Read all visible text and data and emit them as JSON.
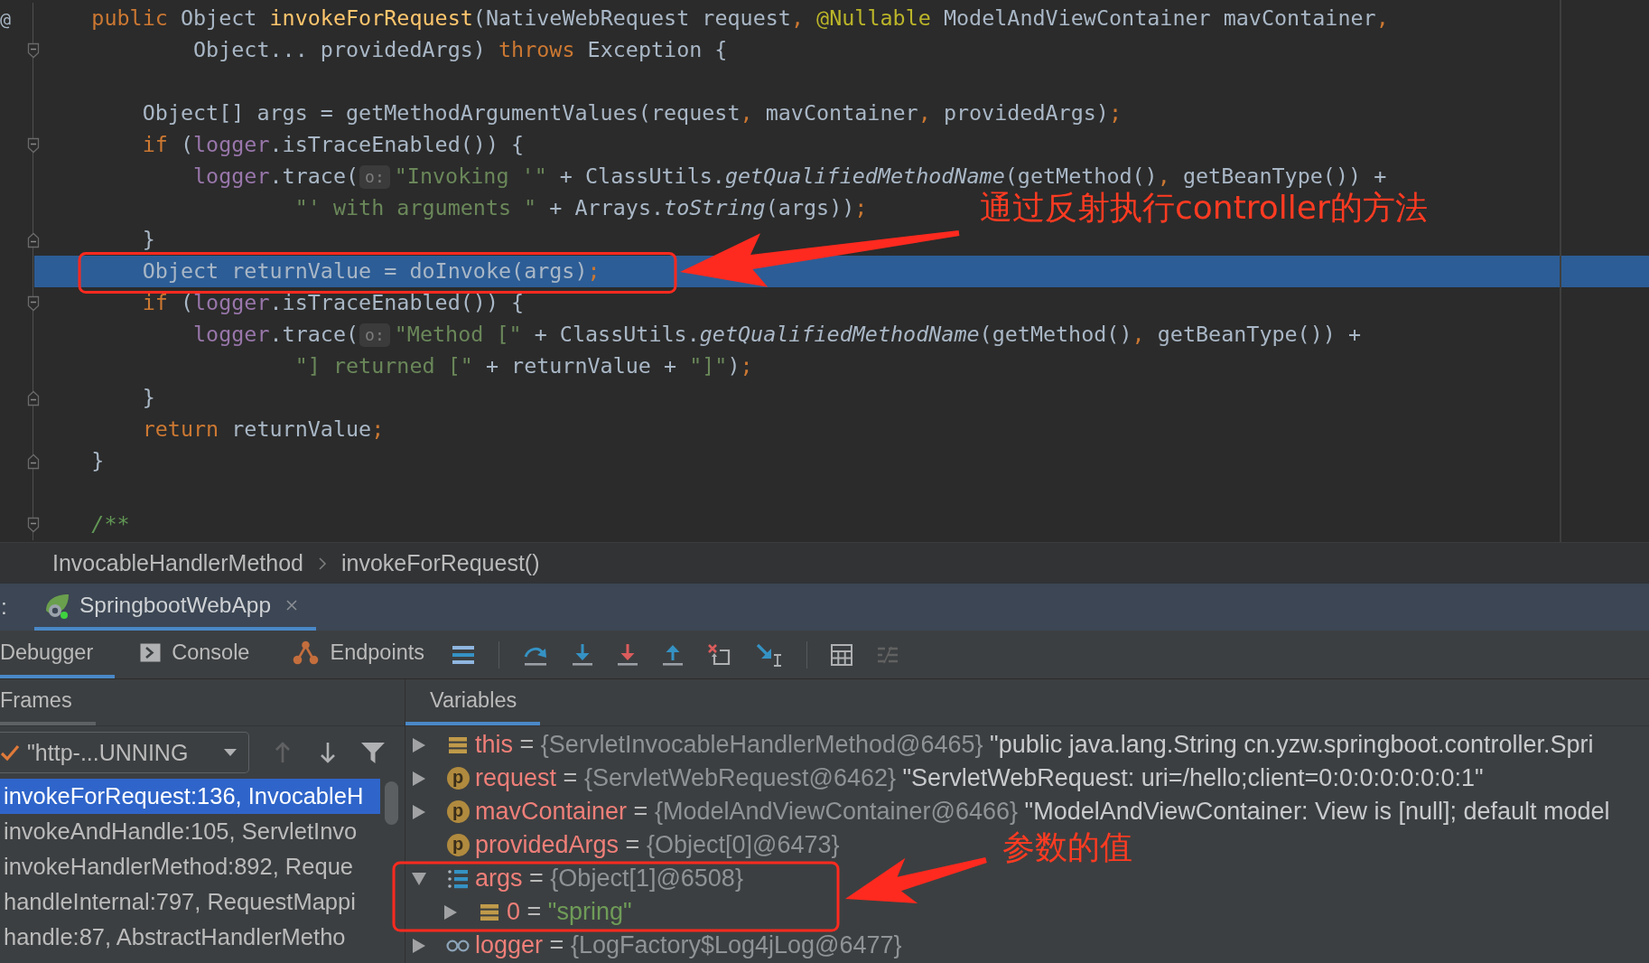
{
  "editor": {
    "lines": [
      {
        "kind": "statement",
        "highlighted": false,
        "fold_open": false,
        "fold_close": false,
        "gutter": "@",
        "tokens": [
          {
            "kind": "keyword",
            "text": "public"
          },
          {
            "kind": "plain",
            "text": " Object "
          },
          {
            "kind": "declaration",
            "text": "invokeForRequest"
          },
          {
            "kind": "plain",
            "text": "(NativeWebRequest request"
          },
          {
            "kind": "punct",
            "text": ", "
          },
          {
            "kind": "annotation",
            "text": "@Nullable"
          },
          {
            "kind": "plain",
            "text": " ModelAndViewContainer mavContainer"
          },
          {
            "kind": "punct",
            "text": ","
          }
        ],
        "children": [
          {
            "kind": "continuation",
            "highlighted": false,
            "fold_open": true,
            "fold_close": false,
            "tokens": [
              {
                "kind": "plain",
                "text": "Object... providedArgs) "
              },
              {
                "kind": "keyword",
                "text": "throws"
              },
              {
                "kind": "plain",
                "text": " Exception {"
              }
            ]
          },
          {
            "kind": "blank"
          },
          {
            "kind": "statement",
            "highlighted": false,
            "fold_open": false,
            "fold_close": false,
            "tokens": [
              {
                "kind": "plain",
                "text": "Object[] args = getMethodArgumentValues(request"
              },
              {
                "kind": "punct",
                "text": ", "
              },
              {
                "kind": "plain",
                "text": "mavContainer"
              },
              {
                "kind": "punct",
                "text": ", "
              },
              {
                "kind": "plain",
                "text": "providedArgs)"
              },
              {
                "kind": "punct",
                "text": ";"
              }
            ]
          },
          {
            "kind": "statement",
            "highlighted": false,
            "fold_open": true,
            "fold_close": false,
            "tokens": [
              {
                "kind": "keyword",
                "text": "if"
              },
              {
                "kind": "plain",
                "text": " ("
              },
              {
                "kind": "field",
                "text": "logger"
              },
              {
                "kind": "plain",
                "text": ".isTraceEnabled()) {"
              }
            ],
            "children": [
              {
                "kind": "statement",
                "highlighted": false,
                "fold_open": false,
                "fold_close": false,
                "tokens": [
                  {
                    "kind": "field",
                    "text": "logger"
                  },
                  {
                    "kind": "plain",
                    "text": ".trace("
                  },
                  {
                    "kind": "hint",
                    "text": "o:"
                  },
                  {
                    "kind": "string",
                    "text": "\"Invoking '\""
                  },
                  {
                    "kind": "plain",
                    "text": " + ClassUtils."
                  },
                  {
                    "kind": "italic",
                    "text": "getQualifiedMethodName"
                  },
                  {
                    "kind": "plain",
                    "text": "(getMethod()"
                  },
                  {
                    "kind": "punct",
                    "text": ", "
                  },
                  {
                    "kind": "plain",
                    "text": "getBeanType()) +"
                  }
                ],
                "children": [
                  {
                    "kind": "continuation",
                    "highlighted": false,
                    "fold_open": false,
                    "fold_close": false,
                    "tokens": [
                      {
                        "kind": "string",
                        "text": "\"' with arguments \""
                      },
                      {
                        "kind": "plain",
                        "text": " + Arrays."
                      },
                      {
                        "kind": "italic",
                        "text": "toString"
                      },
                      {
                        "kind": "plain",
                        "text": "(args))"
                      },
                      {
                        "kind": "punct",
                        "text": ";"
                      }
                    ]
                  }
                ]
              }
            ]
          },
          {
            "kind": "statement",
            "highlighted": false,
            "fold_open": false,
            "fold_close": true,
            "tokens": [
              {
                "kind": "plain",
                "text": "}"
              }
            ]
          },
          {
            "kind": "statement",
            "highlighted": true,
            "fold_open": false,
            "fold_close": false,
            "tokens": [
              {
                "kind": "plain",
                "text": "Object returnValue = doInvoke(args)"
              },
              {
                "kind": "punct",
                "text": ";"
              }
            ]
          },
          {
            "kind": "statement",
            "highlighted": false,
            "fold_open": true,
            "fold_close": false,
            "tokens": [
              {
                "kind": "keyword",
                "text": "if"
              },
              {
                "kind": "plain",
                "text": " ("
              },
              {
                "kind": "field",
                "text": "logger"
              },
              {
                "kind": "plain",
                "text": ".isTraceEnabled()) {"
              }
            ],
            "children": [
              {
                "kind": "statement",
                "highlighted": false,
                "fold_open": false,
                "fold_close": false,
                "tokens": [
                  {
                    "kind": "field",
                    "text": "logger"
                  },
                  {
                    "kind": "plain",
                    "text": ".trace("
                  },
                  {
                    "kind": "hint",
                    "text": "o:"
                  },
                  {
                    "kind": "string",
                    "text": "\"Method [\""
                  },
                  {
                    "kind": "plain",
                    "text": " + ClassUtils."
                  },
                  {
                    "kind": "italic",
                    "text": "getQualifiedMethodName"
                  },
                  {
                    "kind": "plain",
                    "text": "(getMethod()"
                  },
                  {
                    "kind": "punct",
                    "text": ", "
                  },
                  {
                    "kind": "plain",
                    "text": "getBeanType()) +"
                  }
                ],
                "children": [
                  {
                    "kind": "continuation",
                    "highlighted": false,
                    "fold_open": false,
                    "fold_close": false,
                    "tokens": [
                      {
                        "kind": "string",
                        "text": "\"] returned [\""
                      },
                      {
                        "kind": "plain",
                        "text": " + returnValue + "
                      },
                      {
                        "kind": "string",
                        "text": "\"]\""
                      },
                      {
                        "kind": "plain",
                        "text": ")"
                      },
                      {
                        "kind": "punct",
                        "text": ";"
                      }
                    ]
                  }
                ]
              }
            ]
          },
          {
            "kind": "statement",
            "highlighted": false,
            "fold_open": false,
            "fold_close": true,
            "tokens": [
              {
                "kind": "plain",
                "text": "}"
              }
            ]
          },
          {
            "kind": "statement",
            "highlighted": false,
            "fold_open": false,
            "fold_close": false,
            "tokens": [
              {
                "kind": "keyword",
                "text": "return"
              },
              {
                "kind": "plain",
                "text": " returnValue"
              },
              {
                "kind": "punct",
                "text": ";"
              }
            ]
          }
        ]
      },
      {
        "kind": "statement",
        "highlighted": false,
        "fold_open": false,
        "fold_close": true,
        "tokens": [
          {
            "kind": "plain",
            "text": "}"
          }
        ]
      },
      {
        "kind": "blank"
      },
      {
        "kind": "statement",
        "highlighted": false,
        "fold_open": true,
        "fold_close": false,
        "tokens": [
          {
            "kind": "comment",
            "text": "/**"
          }
        ]
      }
    ]
  },
  "breadcrumbs": {
    "items": [
      "InvocableHandlerMethod",
      "invokeForRequest()"
    ]
  },
  "run_tabs": {
    "label": ":",
    "tabs": [
      {
        "label": "SpringbootWebApp",
        "selected": true
      }
    ]
  },
  "debug_toolbar": {
    "tabs": [
      {
        "label": "Debugger",
        "selected": true
      },
      {
        "label": "Console",
        "selected": false
      },
      {
        "label": "Endpoints",
        "selected": false
      }
    ],
    "buttons": [
      {
        "disabled": false
      },
      {
        "disabled": false
      },
      {
        "disabled": false
      },
      {
        "disabled": false
      },
      {
        "disabled": false
      },
      {
        "disabled": false
      },
      {
        "disabled": false
      },
      {
        "disabled": false
      },
      {
        "disabled": true
      }
    ]
  },
  "frames": {
    "title": "Frames",
    "focused": false,
    "thread": "\"http-...UNNING",
    "controls": [
      {
        "disabled": true
      },
      {
        "disabled": false
      },
      {
        "disabled": false
      }
    ],
    "items": [
      {
        "label": "invokeForRequest:136, InvocableH",
        "selected": true
      },
      {
        "label": "invokeAndHandle:105, ServletInvo",
        "selected": false
      },
      {
        "label": "invokeHandlerMethod:892, Reque",
        "selected": false
      },
      {
        "label": "handleInternal:797, RequestMappi",
        "selected": false
      },
      {
        "label": "handle:87, AbstractHandlerMetho",
        "selected": false
      }
    ]
  },
  "variables": {
    "title": "Variables",
    "focused": true,
    "items": [
      {
        "kind": "field",
        "expanded": false,
        "name": "this",
        "operator": "=",
        "value": "{ServletInvocableHandlerMethod@6465}",
        "detail": "\"public java.lang.String cn.yzw.springboot.controller.Spri"
      },
      {
        "kind": "parameter",
        "badge": "p",
        "expanded": false,
        "name": "request",
        "operator": "=",
        "value": "{ServletWebRequest@6462}",
        "detail": "\"ServletWebRequest: uri=/hello;client=0:0:0:0:0:0:0:1\""
      },
      {
        "kind": "parameter",
        "badge": "p",
        "expanded": false,
        "name": "mavContainer",
        "operator": "=",
        "value": "{ModelAndViewContainer@6466}",
        "detail": "\"ModelAndViewContainer: View is [null]; default model"
      },
      {
        "kind": "parameter",
        "badge": "p",
        "name": "providedArgs",
        "operator": "=",
        "value": "{Object[0]@6473}"
      },
      {
        "kind": "array",
        "expanded": true,
        "name": "args",
        "operator": "=",
        "value": "{Object[1]@6508}",
        "children": [
          {
            "kind": "string",
            "expanded": false,
            "name": "0",
            "operator": "=",
            "value": "\"spring\""
          }
        ]
      },
      {
        "kind": "static",
        "expanded": false,
        "name": "logger",
        "operator": "=",
        "value": "{LogFactory$Log4jLog@6477}"
      }
    ]
  },
  "annotations": [
    {
      "text": "通过反射执行controller的方法"
    },
    {
      "text": "参数的值"
    }
  ]
}
